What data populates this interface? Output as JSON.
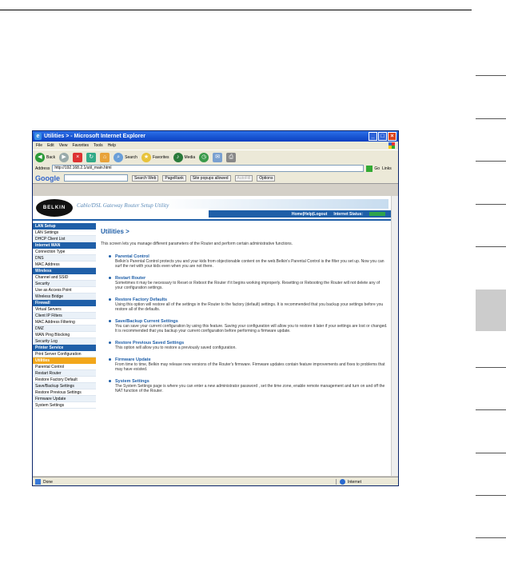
{
  "window": {
    "title": "Utilities > - Microsoft Internet Explorer",
    "menu": [
      "File",
      "Edit",
      "View",
      "Favorites",
      "Tools",
      "Help"
    ],
    "toolbar": [
      "Back",
      "",
      "",
      "",
      "",
      "Search",
      "Favorites",
      "Media",
      "",
      "",
      ""
    ],
    "address_label": "Address",
    "address_value": "http://192.168.2.1/util_main.html",
    "go_label": "Go",
    "links_label": "Links",
    "google": {
      "logo": "Google",
      "search_web": "Search Web",
      "pagerank": "PageRank",
      "popups": "Site popups allowed",
      "autofill": "AutoFill",
      "options": "Options"
    },
    "status_left": "Done",
    "status_zone": "Internet"
  },
  "router": {
    "header_title": "Cable/DSL Gateway Router Setup Utility",
    "logo": "BELKIN",
    "nav": [
      "Home",
      "|",
      "Help",
      "|",
      "Logout",
      "Internet Status:"
    ],
    "sidebar": [
      {
        "type": "head",
        "label": "LAN Setup"
      },
      {
        "type": "item",
        "label": "LAN Settings"
      },
      {
        "type": "item",
        "label": "DHCP Client List"
      },
      {
        "type": "head",
        "label": "Internet WAN"
      },
      {
        "type": "item",
        "label": "Connection Type"
      },
      {
        "type": "item",
        "label": "DNS"
      },
      {
        "type": "item",
        "label": "MAC Address"
      },
      {
        "type": "head",
        "label": "Wireless"
      },
      {
        "type": "item",
        "label": "Channel and SSID"
      },
      {
        "type": "item",
        "label": "Security"
      },
      {
        "type": "item",
        "label": "Use as Access Point"
      },
      {
        "type": "item",
        "label": "Wireless Bridge"
      },
      {
        "type": "head",
        "label": "Firewall"
      },
      {
        "type": "item",
        "label": "Virtual Servers"
      },
      {
        "type": "item",
        "label": "Client IP Filters"
      },
      {
        "type": "item",
        "label": "MAC Address Filtering"
      },
      {
        "type": "item",
        "label": "DMZ"
      },
      {
        "type": "item",
        "label": "WAN Ping Blocking"
      },
      {
        "type": "item",
        "label": "Security Log"
      },
      {
        "type": "head",
        "label": "Printer Service"
      },
      {
        "type": "item",
        "label": "Print Server Configuration"
      },
      {
        "type": "head-active",
        "label": "Utilities"
      },
      {
        "type": "item",
        "label": "Parental Control"
      },
      {
        "type": "item",
        "label": "Restart Router"
      },
      {
        "type": "item",
        "label": "Restore Factory Default"
      },
      {
        "type": "item",
        "label": "Save/Backup Settings"
      },
      {
        "type": "item",
        "label": "Restore Previous Settings"
      },
      {
        "type": "item",
        "label": "Firmware Update"
      },
      {
        "type": "item",
        "label": "System Settings"
      }
    ],
    "content_title": "Utilities >",
    "intro": "This screen lets you manage different parameters of the Router and perform certain administrative functions.",
    "sections": [
      {
        "title": "Parental Control",
        "desc": "Belkin's Parental Control protects you and your kids from objectionable content on the web.Belkin's Parental Control is the filter you set up. Now you can surf the net with your kids even when you are not there."
      },
      {
        "title": "Restart Router",
        "desc": "Sometimes it may be necessary to Reset or Reboot the Router if it begins working improperly. Resetting or Rebooting the Router will not delete any of your configuration settings."
      },
      {
        "title": "Restore Factory Defaults",
        "desc": "Using this option will restore all of the settings in the Router to the factory (default) settings. It is recommended that you backup your settings before you restore all of the defaults."
      },
      {
        "title": "Save/Backup Current Settings",
        "desc": "You can save your current configuration by using this feature. Saving your configuration will allow you to restore it later if your settings are lost or changed. It is recommended that you backup your current configuration before performing a firmware update."
      },
      {
        "title": "Restore Previous Saved Settings",
        "desc": "This option will allow you to restore a previously saved configuration."
      },
      {
        "title": "Firmware Update",
        "desc": "From time to time, Belkin may release new versions of the Router's firmware. Firmware updates contain feature improvements and fixes to problems that may have existed."
      },
      {
        "title": "System Settings",
        "desc": "The System Settings page is where you can enter a new administrator password , set the time zone, enable remote management and turn on and off the NAT function of the Router."
      }
    ]
  }
}
